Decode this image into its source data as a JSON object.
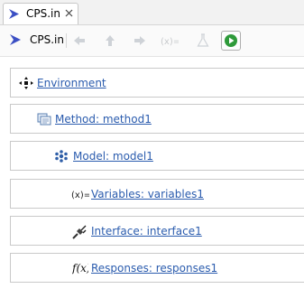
{
  "tab": {
    "label": "CPS.in",
    "file_icon": "cps-file-icon",
    "close_icon": "close-icon"
  },
  "toolbar": {
    "title": "CPS.in",
    "buttons": [
      {
        "name": "back-button",
        "icon": "arrow-left-icon",
        "enabled": false
      },
      {
        "name": "up-button",
        "icon": "arrow-up-icon",
        "enabled": false
      },
      {
        "name": "forward-button",
        "icon": "arrow-right-icon",
        "enabled": false
      },
      {
        "name": "variables-button",
        "icon": "variables-icon",
        "enabled": false
      },
      {
        "name": "flask-button",
        "icon": "flask-icon",
        "enabled": false
      },
      {
        "name": "run-button",
        "icon": "play-icon",
        "enabled": true
      }
    ]
  },
  "tree": {
    "environment": {
      "label": "Environment",
      "icon": "environment-icon"
    },
    "method": {
      "label": "Method: method1",
      "icon": "method-icon"
    },
    "model": {
      "label": "Model: model1",
      "icon": "model-icon"
    },
    "variables": {
      "label": "Variables: variables1",
      "icon": "variables-icon"
    },
    "interface": {
      "label": "Interface: interface1",
      "icon": "interface-icon"
    },
    "responses": {
      "label": "Responses: responses1",
      "icon": "responses-icon"
    }
  },
  "colors": {
    "link": "#2b5cae",
    "run_green": "#2e9a3a",
    "accent_blue": "#3b4fc4"
  }
}
